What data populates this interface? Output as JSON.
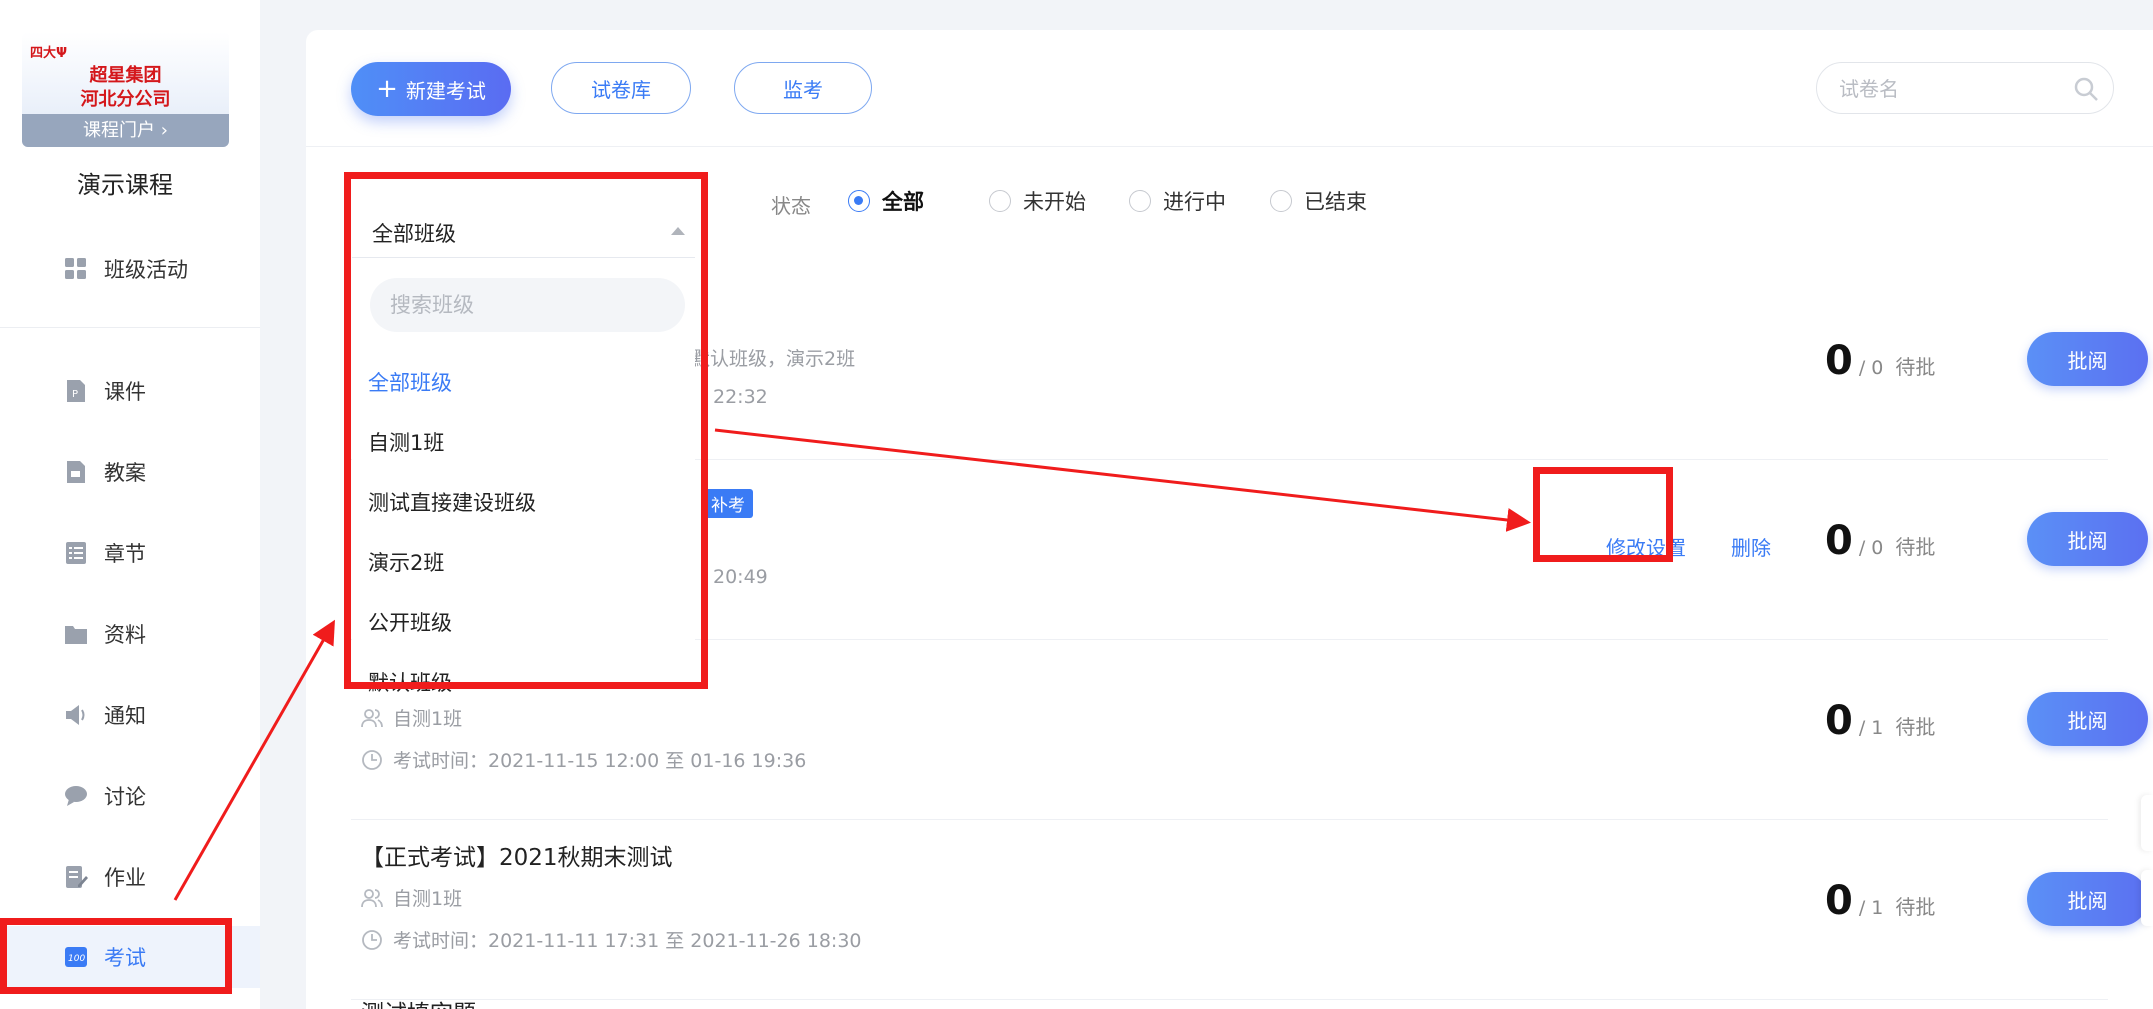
{
  "sidebar": {
    "cover": {
      "logo_text": "四大Ψ",
      "name": "超星集团\n河北分公司",
      "portal_label": "课程门户 ›"
    },
    "course_title": "演示课程",
    "items": [
      {
        "label": "班级活动",
        "icon": "grid-icon"
      },
      {
        "label": "课件",
        "icon": "ppt-file-icon"
      },
      {
        "label": "教案",
        "icon": "lesson-plan-icon"
      },
      {
        "label": "章节",
        "icon": "list-icon"
      },
      {
        "label": "资料",
        "icon": "folder-icon"
      },
      {
        "label": "通知",
        "icon": "speaker-icon"
      },
      {
        "label": "讨论",
        "icon": "chat-icon"
      },
      {
        "label": "作业",
        "icon": "homework-icon"
      },
      {
        "label": "考试",
        "icon": "exam-100-icon",
        "active": true
      }
    ]
  },
  "toolbar": {
    "new_exam_label": "新建考试",
    "paper_bank_label": "试卷库",
    "proctor_label": "监考",
    "search_placeholder": "试卷名"
  },
  "filter": {
    "class_select_value": "全部班级",
    "status_label": "状态",
    "status_options": [
      {
        "label": "全部",
        "checked": true
      },
      {
        "label": "未开始",
        "checked": false
      },
      {
        "label": "进行中",
        "checked": false
      },
      {
        "label": "已结束",
        "checked": false
      }
    ]
  },
  "dropdown": {
    "search_placeholder": "搜索班级",
    "options": [
      "全部班级",
      "自测1班",
      "测试直接建设班级",
      "演示2班",
      "公开班级",
      "默认班级"
    ],
    "selected": "全部班级"
  },
  "exams": [
    {
      "title": "",
      "classes": "默认班级，演示2班",
      "time": "22:32",
      "submitted": "0",
      "total": "/ 0",
      "pending": "待批",
      "grade_label": "批阅"
    },
    {
      "title": "",
      "tag": "补考",
      "classes": "",
      "time": "20:49",
      "submitted": "0",
      "total": "/ 0",
      "pending": "待批",
      "grade_label": "批阅",
      "edit_label": "修改设置",
      "delete_label": "删除"
    },
    {
      "title": "",
      "classes": "自测1班",
      "time": "考试时间：2021-11-15 12:00 至 01-16 19:36",
      "submitted": "0",
      "total": "/ 1",
      "pending": "待批",
      "grade_label": "批阅"
    },
    {
      "title": "【正式考试】2021秋期末测试",
      "classes": "自测1班",
      "time": "考试时间：2021-11-11 17:31 至 2021-11-26 18:30",
      "submitted": "0",
      "total": "/ 1",
      "pending": "待批",
      "grade_label": "批阅"
    },
    {
      "title": "测试填空题"
    }
  ],
  "colors": {
    "accent": "#3a7bf5",
    "annotation": "#f01c1c",
    "cover_red": "#d4171b"
  }
}
